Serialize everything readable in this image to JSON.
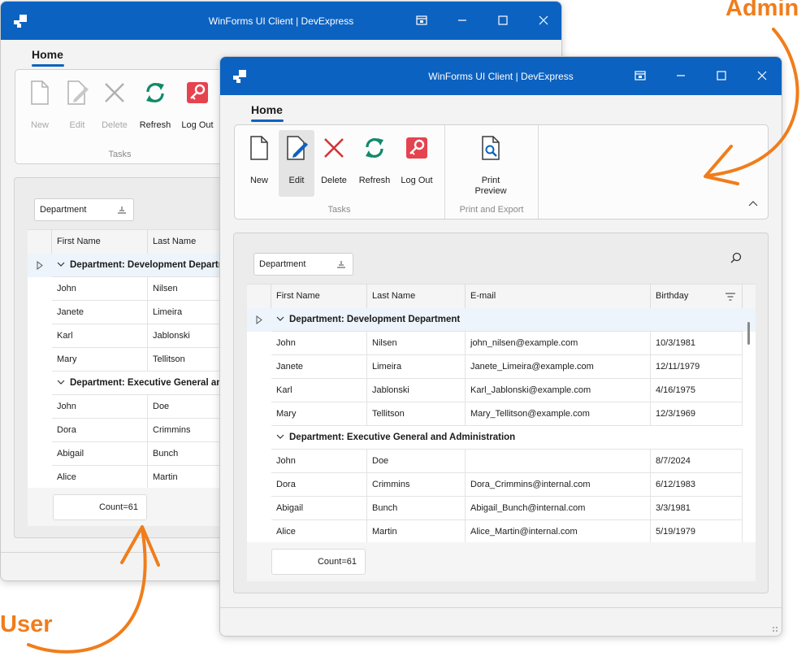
{
  "windows": {
    "user": {
      "title": "WinForms UI Client | DevExpress",
      "tab": "Home",
      "buttons": {
        "new": "New",
        "edit": "Edit",
        "delete": "Delete",
        "refresh": "Refresh",
        "logout": "Log Out"
      },
      "group_tasks": "Tasks",
      "groupby": "Department",
      "columns": [
        "First Name",
        "Last Name"
      ],
      "groups": [
        {
          "label": "Department: Development Department",
          "rows": [
            [
              "John",
              "Nilsen"
            ],
            [
              "Janete",
              "Limeira"
            ],
            [
              "Karl",
              "Jablonski"
            ],
            [
              "Mary",
              "Tellitson"
            ]
          ]
        },
        {
          "label": "Department: Executive General and Administration",
          "rows": [
            [
              "John",
              "Doe"
            ],
            [
              "Dora",
              "Crimmins"
            ],
            [
              "Abigail",
              "Bunch"
            ],
            [
              "Alice",
              "Martin"
            ]
          ]
        }
      ],
      "count": "Count=61"
    },
    "admin": {
      "title": "WinForms UI Client | DevExpress",
      "tab": "Home",
      "buttons": {
        "new": "New",
        "edit": "Edit",
        "delete": "Delete",
        "refresh": "Refresh",
        "logout": "Log Out",
        "print_preview": "Print Preview"
      },
      "group_tasks": "Tasks",
      "group_print": "Print and Export",
      "groupby": "Department",
      "columns": [
        "First Name",
        "Last Name",
        "E-mail",
        "Birthday"
      ],
      "groups": [
        {
          "label": "Department: Development Department",
          "rows": [
            [
              "John",
              "Nilsen",
              "john_nilsen@example.com",
              "10/3/1981"
            ],
            [
              "Janete",
              "Limeira",
              "Janete_Limeira@example.com",
              "12/11/1979"
            ],
            [
              "Karl",
              "Jablonski",
              "Karl_Jablonski@example.com",
              "4/16/1975"
            ],
            [
              "Mary",
              "Tellitson",
              "Mary_Tellitson@example.com",
              "12/3/1969"
            ]
          ]
        },
        {
          "label": "Department: Executive General and Administration",
          "rows": [
            [
              "John",
              "Doe",
              "",
              "8/7/2024"
            ],
            [
              "Dora",
              "Crimmins",
              "Dora_Crimmins@internal.com",
              "6/12/1983"
            ],
            [
              "Abigail",
              "Bunch",
              "Abigail_Bunch@internal.com",
              "3/3/1981"
            ],
            [
              "Alice",
              "Martin",
              "Alice_Martin@internal.com",
              "5/19/1979"
            ]
          ]
        }
      ],
      "count": "Count=61"
    }
  },
  "callouts": {
    "admin": "Admin",
    "user": "User"
  },
  "colors": {
    "accent": "#0c62c0",
    "callout": "#f07d1b",
    "delete_red": "#d13438",
    "refresh_green": "#0f8a6a",
    "logout_red": "#e5434f"
  },
  "icons": [
    "app-icon",
    "restore-icon",
    "minimize-icon",
    "maximize-icon",
    "close-icon",
    "new-icon",
    "edit-icon",
    "delete-icon",
    "refresh-icon",
    "logout-key-icon",
    "print-preview-icon",
    "sort-icon",
    "search-icon",
    "filter-icon",
    "expand-triangle-icon",
    "chevron-down-icon",
    "collapse-ribbon-icon",
    "resize-grip-icon"
  ]
}
